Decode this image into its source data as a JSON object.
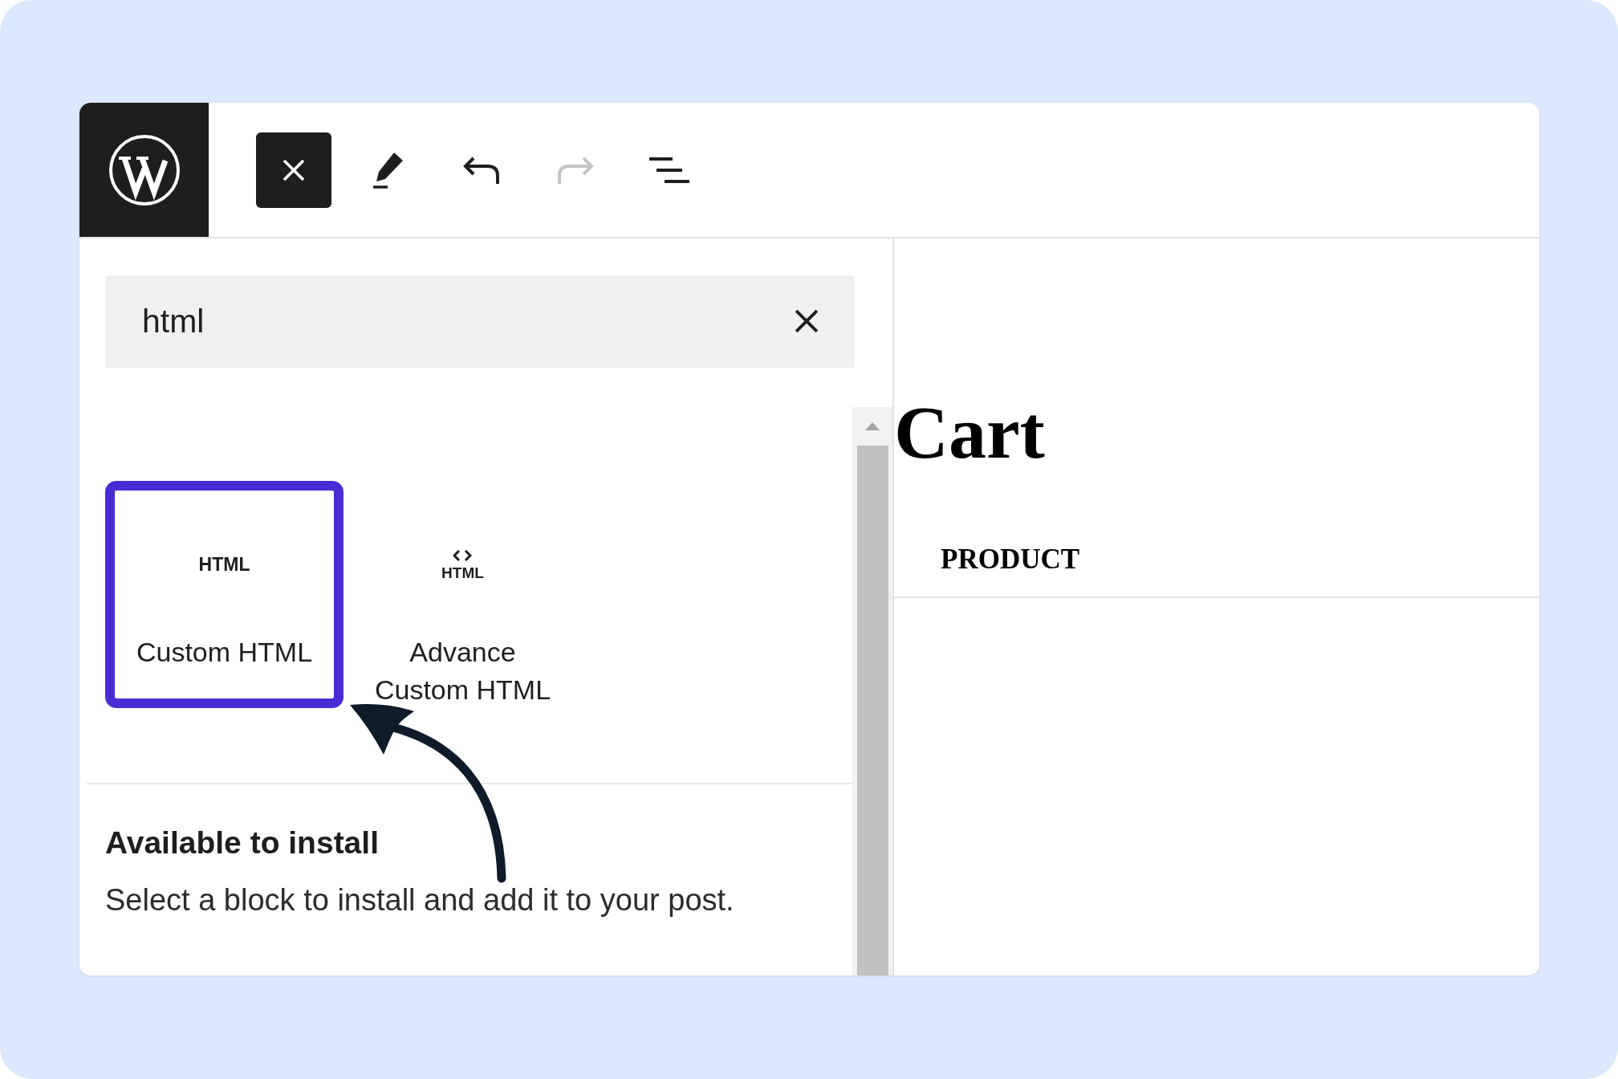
{
  "header": {
    "tools": [
      {
        "kind": "close",
        "pressed": true,
        "disabled": false
      },
      {
        "kind": "edit",
        "pressed": false,
        "disabled": false
      },
      {
        "kind": "undo",
        "pressed": false,
        "disabled": false
      },
      {
        "kind": "redo",
        "pressed": false,
        "disabled": true
      },
      {
        "kind": "list-view",
        "pressed": false,
        "disabled": false
      }
    ]
  },
  "inserter": {
    "search": {
      "value": "html"
    },
    "blocks": [
      {
        "kind": "text-icon",
        "icon_text": "HTML",
        "label": "Custom HTML",
        "selected": true
      },
      {
        "kind": "code-icon",
        "icon_text": "HTML",
        "label": "Advance Custom HTML",
        "selected": false
      }
    ],
    "install_section": {
      "title": "Available to install",
      "description": "Select a block to install and add it to your post."
    }
  },
  "editor": {
    "title": "Cart",
    "table": {
      "columns": [
        "PRODUCT"
      ]
    }
  }
}
